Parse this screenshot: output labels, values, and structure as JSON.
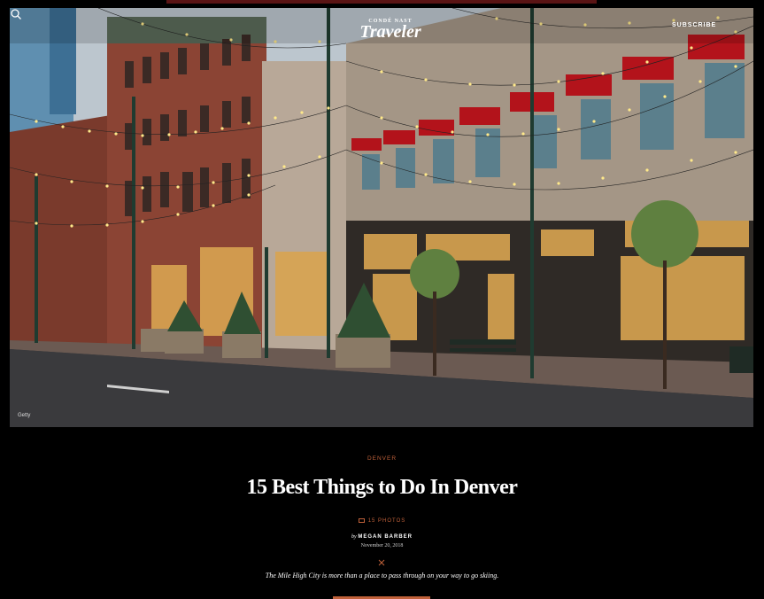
{
  "brand": {
    "parent": "CONDÉ NAST",
    "name": "Traveler"
  },
  "header": {
    "subscribe_label": "SUBSCRIBE"
  },
  "hero": {
    "credit": "Getty"
  },
  "article": {
    "category": "DENVER",
    "title": "15 Best Things to Do In Denver",
    "photos_label": "15 PHOTOS",
    "by": "by",
    "author": "MEGAN BARBER",
    "date": "November 20, 2018",
    "dek": "The Mile High City is more than a place to pass through on your way to go skiing."
  },
  "colors": {
    "accent": "#c0613a",
    "background": "#000000",
    "awning": "#b3131b"
  }
}
